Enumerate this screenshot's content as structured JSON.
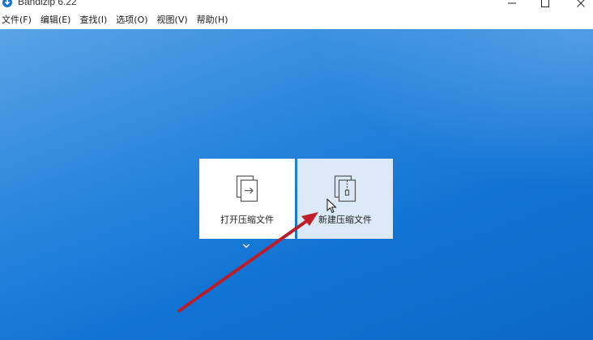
{
  "window": {
    "title": "Bandizip 6.22",
    "icon": "bandizip-logo-icon",
    "controls": [
      "minimize-icon",
      "maximize-icon",
      "close-icon"
    ]
  },
  "menu": {
    "items": [
      {
        "label": "文件(F)"
      },
      {
        "label": "编辑(E)"
      },
      {
        "label": "查找(I)"
      },
      {
        "label": "选项(O)"
      },
      {
        "label": "视图(V)"
      },
      {
        "label": "帮助(H)"
      }
    ]
  },
  "tiles": {
    "open": {
      "label": "打开压缩文件",
      "icon": "open-archive-icon"
    },
    "new": {
      "label": "新建压缩文件",
      "icon": "new-archive-icon"
    }
  },
  "colors": {
    "background": "#1473d4",
    "tile_open_bg": "#ffffff",
    "tile_new_bg": "#dbe9f6",
    "annotation_arrow": "#c0202a"
  }
}
